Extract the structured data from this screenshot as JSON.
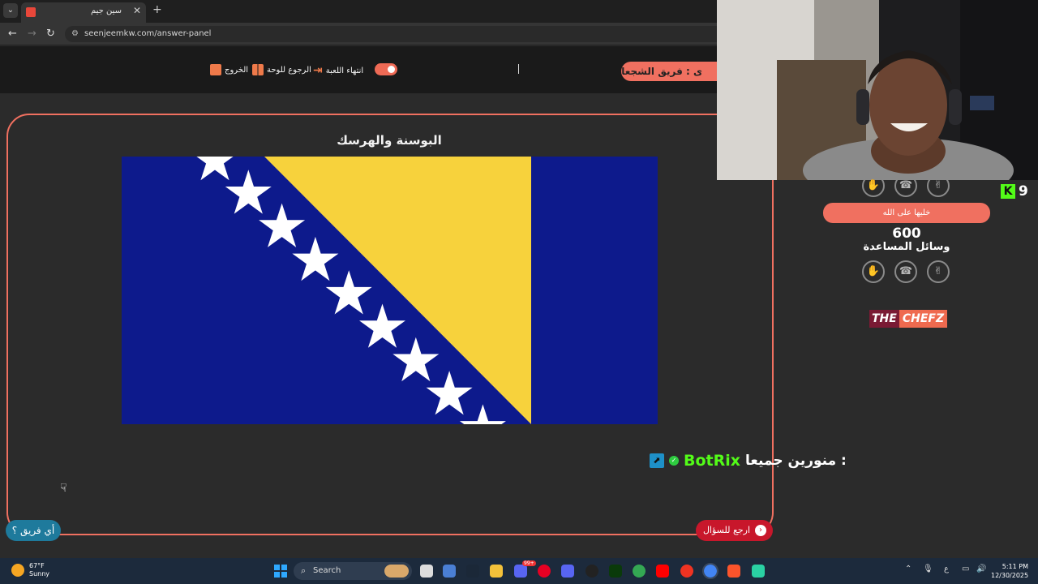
{
  "browser": {
    "tab_title": "سين جيم",
    "new_tab_icon": "plus-icon",
    "url": "seenjeemkw.com/answer-panel"
  },
  "toolbar": {
    "exit_label": "الخروج",
    "back_to_board_label": "الرجوع للوحة",
    "end_game_label": "انتهاء اللعبة",
    "team_label": "ى : فريق الشجعان"
  },
  "question": {
    "country_name": "البوسنة والهرسك"
  },
  "flag": {
    "colors": {
      "blue": "#0d1a8c",
      "yellow": "#f7d23c",
      "star": "#ffffff"
    }
  },
  "buttons": {
    "which_team": "أي فريق ؟",
    "back_to_question": "ارجع للسؤال"
  },
  "chat": {
    "username": "BotRix",
    "message": ": منورين جميعا"
  },
  "side_panel": {
    "kick_count": "9",
    "leave_it_label": "خليها على الله",
    "score": "600",
    "aids_label": "وسائل المساعدة",
    "sponsor_part1": "THE",
    "sponsor_part2": "CHEFZ"
  },
  "taskbar": {
    "temperature": "67°F",
    "weather": "Sunny",
    "search_placeholder": "Search",
    "time": "5:11 PM",
    "date": "12/30/2025",
    "lang": "ع",
    "notifications": "99+"
  },
  "colors": {
    "accent": "#f07060",
    "card_bg": "#2b2b2b",
    "kick_green": "#53fc18",
    "team_blue": "#1e7a9c",
    "return_red": "#c8172b"
  }
}
